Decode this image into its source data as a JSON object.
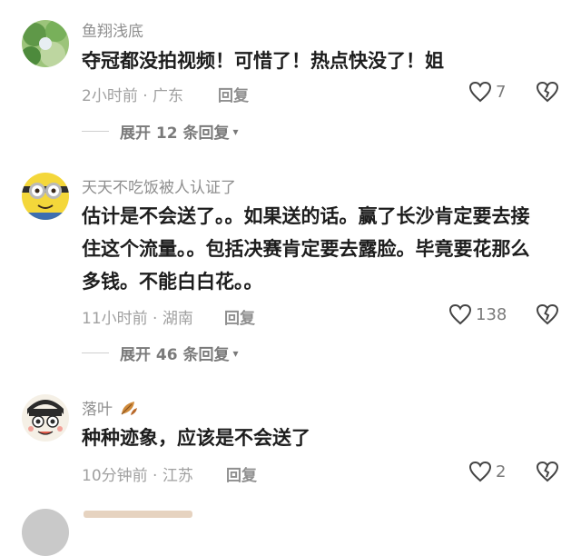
{
  "comments": [
    {
      "username": "鱼翔浅底",
      "lines": [
        "夺冠都没拍视频！可惜了！热点快没了！姐"
      ],
      "time_location": "2小时前 · 广东",
      "reply_label": "回复",
      "likes": "7",
      "expand_label": "展开 12 条回复"
    },
    {
      "username": "天天不吃饭被人认证了",
      "lines": [
        "估计是不会送了。。如果送的话。赢了长沙肯定要去接",
        "住这个流量。。包括决赛肯定要去露脸。毕竟要花那么",
        "多钱。不能白白花。。"
      ],
      "time_location": "11小时前 · 湖南",
      "reply_label": "回复",
      "likes": "138",
      "expand_label": "展开 46 条回复"
    },
    {
      "username": "落叶",
      "lines": [
        "种种迹象，应该是不会送了"
      ],
      "time_location": "10分钟前 · 江苏",
      "reply_label": "回复",
      "likes": "2"
    }
  ],
  "icons": {
    "like": "heart-outline-icon",
    "dislike": "broken-heart-icon",
    "expand": "chevron-down-icon",
    "leaf": "leaf-icon"
  }
}
